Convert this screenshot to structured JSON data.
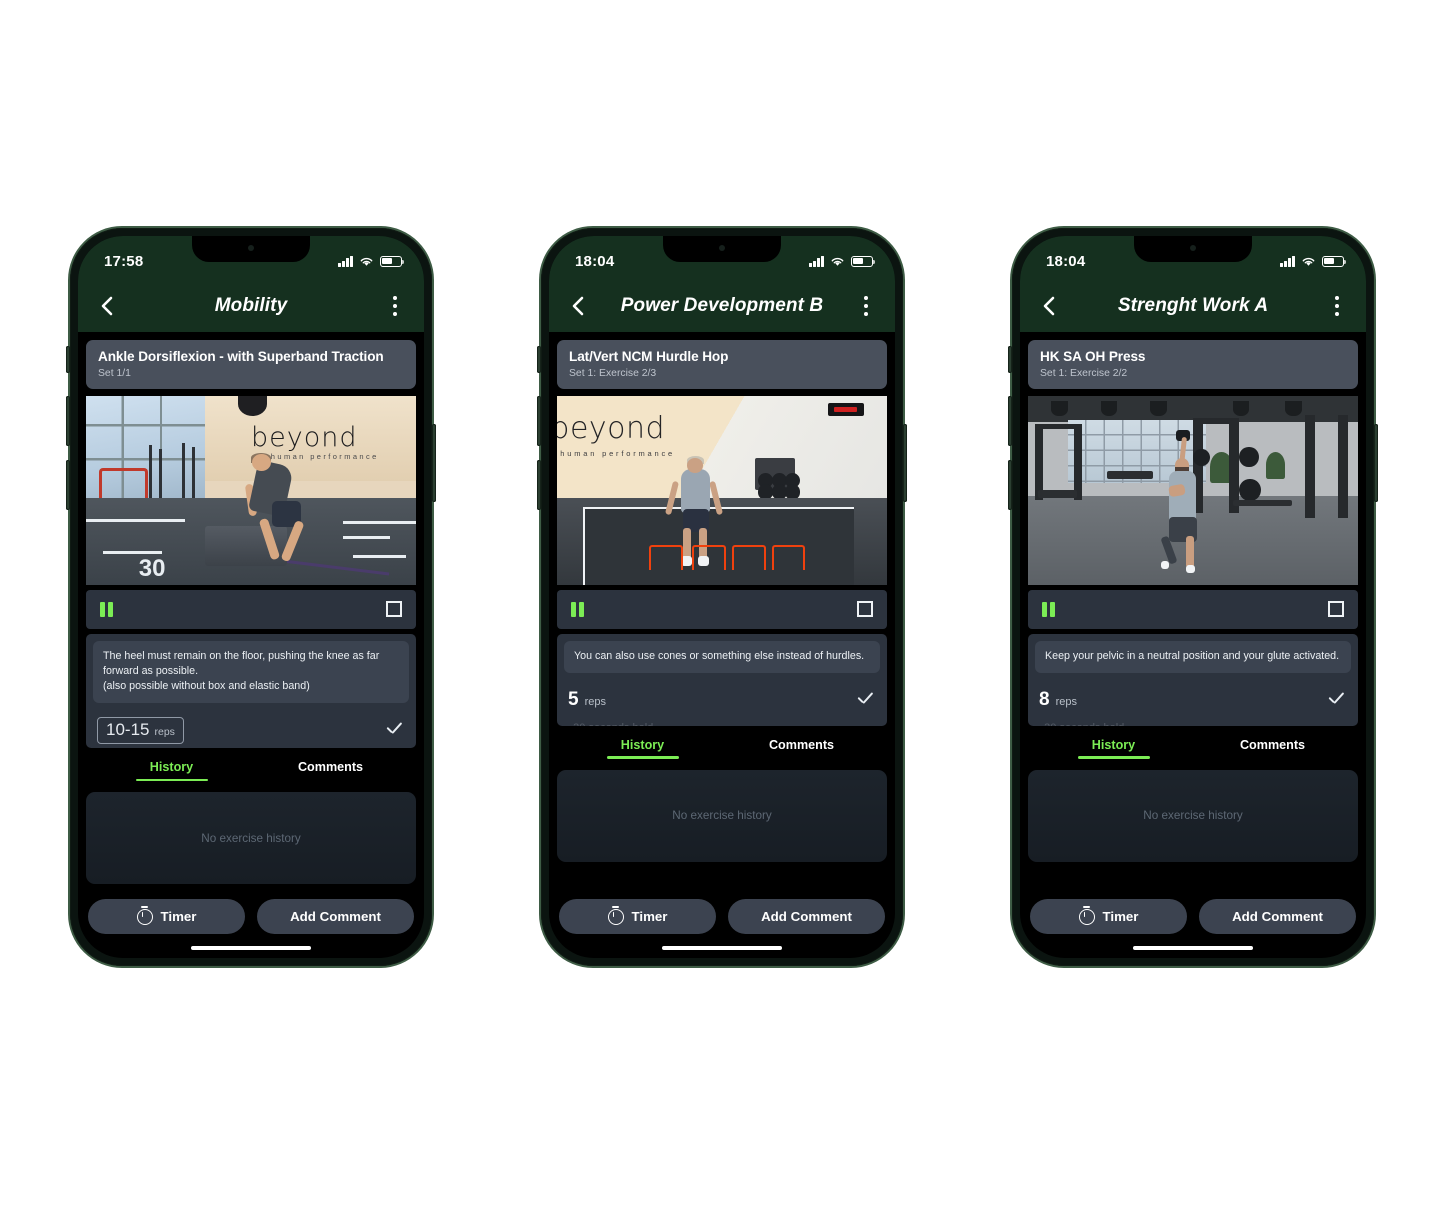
{
  "app": {
    "accent_green": "#7ced55",
    "header_green": "#15301f",
    "panel_slate": "#2c333e",
    "card_slate": "#49505c"
  },
  "phones": [
    {
      "status": {
        "time": "17:58",
        "signal_icon": "cellular-signal-icon",
        "wifi_icon": "wifi-icon",
        "battery_icon": "battery-icon"
      },
      "nav": {
        "back_icon": "chevron-left-icon",
        "title": "Mobility",
        "menu_icon": "kebab-menu-icon"
      },
      "exercise": {
        "name": "Ankle Dorsiflexion - with Superband Traction",
        "set_label": "Set 1/1"
      },
      "video": {
        "pause_icon": "pause-icon",
        "fullscreen_icon": "fullscreen-icon",
        "brand": "beyond",
        "brand_sub": "human performance",
        "floor_number": "30"
      },
      "note": "The heel must remain on the floor, pushing the knee as far forward as possible.\n(also possible without box and elastic band)",
      "reps": {
        "style": "boxed",
        "value": "10-15",
        "unit": "reps",
        "check_icon": "check-icon"
      },
      "tabs": [
        {
          "label": "History",
          "active": true
        },
        {
          "label": "Comments",
          "active": false
        }
      ],
      "history_empty": "No exercise history",
      "actions": {
        "timer_label": "Timer",
        "timer_icon": "stopwatch-icon",
        "comment_label": "Add Comment"
      }
    },
    {
      "status": {
        "time": "18:04",
        "signal_icon": "cellular-signal-icon",
        "wifi_icon": "wifi-icon",
        "battery_icon": "battery-icon"
      },
      "nav": {
        "back_icon": "chevron-left-icon",
        "title": "Power Development B",
        "menu_icon": "kebab-menu-icon"
      },
      "exercise": {
        "name": "Lat/Vert NCM Hurdle Hop",
        "set_label": "Set 1: Exercise 2/3"
      },
      "video": {
        "pause_icon": "pause-icon",
        "fullscreen_icon": "fullscreen-icon",
        "brand": "beyond",
        "brand_sub": "human performance",
        "floor_number": ""
      },
      "note": "You can also use cones or something else instead of hurdles.",
      "reps": {
        "style": "plain",
        "value": "5",
        "unit": "reps",
        "check_icon": "check-icon"
      },
      "tabs": [
        {
          "label": "History",
          "active": true
        },
        {
          "label": "Comments",
          "active": false
        }
      ],
      "history_empty": "No exercise history",
      "actions": {
        "timer_label": "Timer",
        "timer_icon": "stopwatch-icon",
        "comment_label": "Add Comment"
      }
    },
    {
      "status": {
        "time": "18:04",
        "signal_icon": "cellular-signal-icon",
        "wifi_icon": "wifi-icon",
        "battery_icon": "battery-icon"
      },
      "nav": {
        "back_icon": "chevron-left-icon",
        "title": "Strenght Work A",
        "menu_icon": "kebab-menu-icon"
      },
      "exercise": {
        "name": "HK SA OH Press",
        "set_label": "Set 1: Exercise 2/2"
      },
      "video": {
        "pause_icon": "pause-icon",
        "fullscreen_icon": "fullscreen-icon",
        "brand": "",
        "brand_sub": "",
        "floor_number": ""
      },
      "note": "Keep your pelvic in a neutral position and your glute activated.",
      "reps": {
        "style": "plain",
        "value": "8",
        "unit": "reps",
        "check_icon": "check-icon"
      },
      "tabs": [
        {
          "label": "History",
          "active": true
        },
        {
          "label": "Comments",
          "active": false
        }
      ],
      "history_empty": "No exercise history",
      "actions": {
        "timer_label": "Timer",
        "timer_icon": "stopwatch-icon",
        "comment_label": "Add Comment"
      }
    }
  ]
}
